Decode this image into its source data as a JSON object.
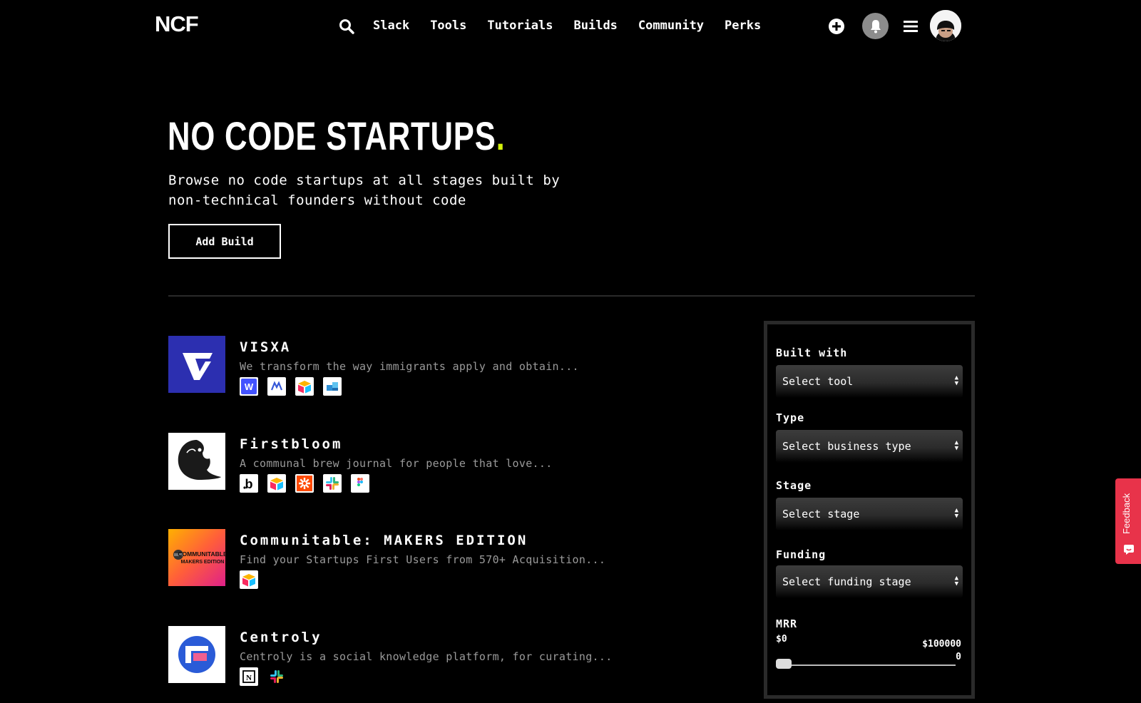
{
  "nav": {
    "logo": "NCF",
    "links": [
      "Slack",
      "Tools",
      "Tutorials",
      "Builds",
      "Community",
      "Perks"
    ]
  },
  "hero": {
    "title": "NO CODE STARTUPS",
    "title_dot": ".",
    "subtitle_line1": "Browse no code startups at all stages built by",
    "subtitle_line2": "non-technical founders without code",
    "add_build_label": "Add Build",
    "accent_color": "#d4f20a"
  },
  "builds": [
    {
      "name": "VISXA",
      "description": "We transform the way immigrants apply and obtain...",
      "tools": [
        "webflow-icon",
        "make-icon",
        "airtable-icon",
        "softr-icon"
      ]
    },
    {
      "name": "Firstbloom",
      "description": "A communal brew journal for people that love...",
      "tools": [
        "bubble-icon",
        "airtable-icon",
        "zapier-icon",
        "slack-icon",
        "figma-icon"
      ]
    },
    {
      "name": "Communitable: MAKERS EDITION",
      "description": "Find your Startups First Users from 570+ Acquisition...",
      "logo_text_1": "COMMUNITABLE",
      "logo_text_2": "MAKERS EDITION",
      "tools": [
        "airtable-icon"
      ]
    },
    {
      "name": "Centroly",
      "description": "Centroly is a social knowledge platform, for curating...",
      "tools": [
        "notion-icon",
        "slack-icon"
      ]
    }
  ],
  "filters": {
    "built_with_label": "Built with",
    "built_with_value": "Select tool",
    "type_label": "Type",
    "type_value": "Select business type",
    "stage_label": "Stage",
    "stage_value": "Select stage",
    "funding_label": "Funding",
    "funding_value": "Select funding stage",
    "mrr_label": "MRR",
    "mrr_min": "$0",
    "mrr_max_line1": "$100000",
    "mrr_max_line2": "0",
    "mrr_slider_position": 0
  },
  "feedback_label": "Feedback",
  "colors": {
    "feedback": "#e8334a",
    "visxa": "#2c2fb0"
  }
}
